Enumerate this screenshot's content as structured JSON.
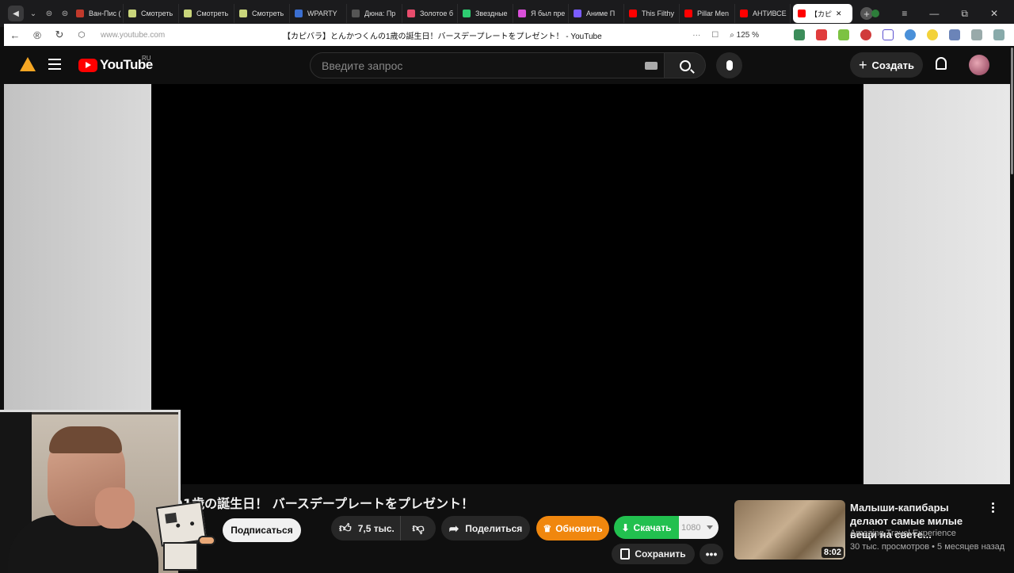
{
  "browser": {
    "tabs": [
      {
        "label": "Ван-Пис (",
        "color": "#c0392b"
      },
      {
        "label": "Смотреть",
        "color": "#c9d57b"
      },
      {
        "label": "Смотреть",
        "color": "#c9d57b"
      },
      {
        "label": "Смотреть",
        "color": "#c9d57b"
      },
      {
        "label": "WPARTY",
        "color": "#3b6fd1"
      },
      {
        "label": "Дюна: Пр",
        "color": "#555555"
      },
      {
        "label": "Золотое б",
        "color": "#e74c6c"
      },
      {
        "label": "Звездные",
        "color": "#2ecc71"
      },
      {
        "label": "Я был пре",
        "color": "#d94fd9"
      },
      {
        "label": "Аниме П",
        "color": "#7a5cff"
      },
      {
        "label": "This Filthy",
        "color": "#ff0000"
      },
      {
        "label": "Pillar Men",
        "color": "#ff0000"
      },
      {
        "label": "АНТИВСЕ",
        "color": "#ff0000"
      },
      {
        "label": "【カピ",
        "color": "#ff0000"
      }
    ],
    "window_controls": [
      "≡",
      "—",
      "⧉",
      "✕"
    ],
    "url": "www.youtube.com",
    "page_title": "【カピバラ】とんかつくんの1歳の誕生日！バースデープレートをプレゼント！ - YouTube",
    "zoom": "125 %"
  },
  "youtube": {
    "logo_text": "YouTube",
    "region": "RU",
    "search_placeholder": "Введите запрос",
    "create_label": "Создать"
  },
  "video": {
    "title_visible": "の1歳の誕生日！ バースデープレートをプレゼント！",
    "subscribe_label": "Подписаться",
    "likes": "7,5 тыс.",
    "share_label": "Поделиться",
    "upgrade_label": "Обновить",
    "download_label": "Скачать",
    "download_quality": "1080",
    "save_label": "Сохранить",
    "more_label": "•••"
  },
  "recommendation": {
    "title": "Малыши-капибары делают самые милые вещи на свете...",
    "channel": "Amazing Travel Experience",
    "meta": "30 тыс. просмотров • 5 месяцев назад",
    "duration": "8:02"
  },
  "colors": {
    "accent_red": "#ff0000",
    "upgrade_orange": "#f0870e",
    "download_green": "#22c04f"
  }
}
